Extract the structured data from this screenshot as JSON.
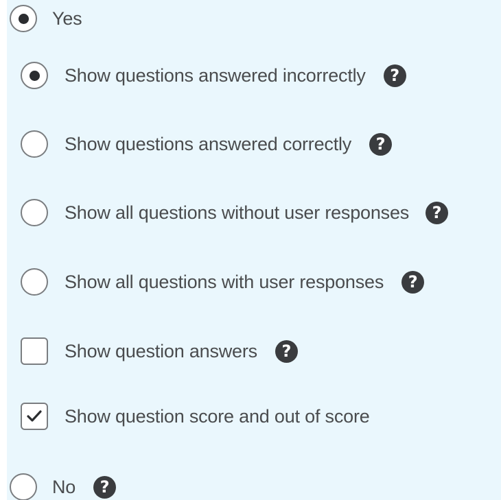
{
  "options": {
    "yes": {
      "label": "Yes",
      "selected": true
    },
    "show_incorrect": {
      "label": "Show questions answered incorrectly",
      "selected": true
    },
    "show_correct": {
      "label": "Show questions answered correctly",
      "selected": false
    },
    "show_all_without_responses": {
      "label": "Show all questions without user responses",
      "selected": false
    },
    "show_all_with_responses": {
      "label": "Show all questions with user responses",
      "selected": false
    },
    "show_answers": {
      "label": "Show question answers",
      "checked": false
    },
    "show_score": {
      "label": "Show question score and out of score",
      "checked": true
    },
    "no": {
      "label": "No",
      "selected": false
    }
  },
  "icons": {
    "help": "?",
    "radio_selected": "radio-dot",
    "checkbox_checked": "checkmark"
  },
  "colors": {
    "panel_background": "#eaf7fd",
    "text": "#4a4c4e",
    "control_border": "#7a7d80",
    "help_icon": "#3a3c3f"
  }
}
